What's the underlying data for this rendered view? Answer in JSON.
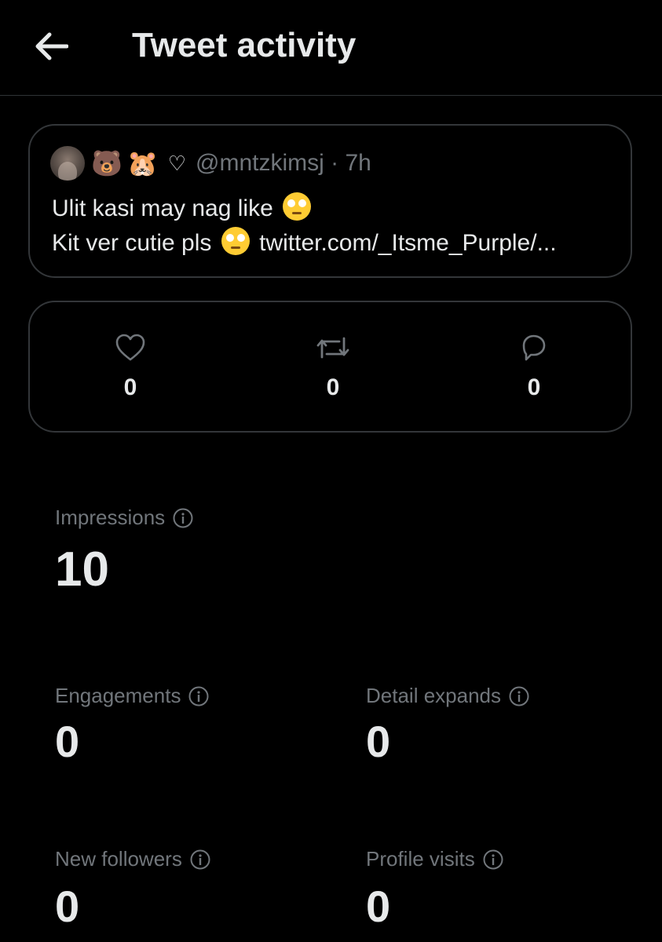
{
  "header": {
    "title": "Tweet activity"
  },
  "tweet": {
    "handle": "@mntzkimsj · 7h",
    "line1": "Ulit kasi may nag like",
    "line2_text": "Kit ver cutie pls",
    "line2_link": "twitter.com/_Itsme_Purple/...",
    "name_emojis": [
      "🐻",
      "🐹",
      "♡"
    ]
  },
  "engagement_counts": {
    "likes": "0",
    "retweets": "0",
    "replies": "0"
  },
  "stats": {
    "impressions": {
      "label": "Impressions",
      "value": "10"
    },
    "engagements": {
      "label": "Engagements",
      "value": "0"
    },
    "detail_expands": {
      "label": "Detail expands",
      "value": "0"
    },
    "new_followers": {
      "label": "New followers",
      "value": "0"
    },
    "profile_visits": {
      "label": "Profile visits",
      "value": "0"
    }
  },
  "icons": [
    "back-arrow-icon",
    "heart-icon",
    "retweet-icon",
    "reply-icon",
    "info-icon"
  ],
  "colors": {
    "background": "#000000",
    "text": "#e7e9ea",
    "secondary": "#71767b",
    "border": "#333639"
  }
}
